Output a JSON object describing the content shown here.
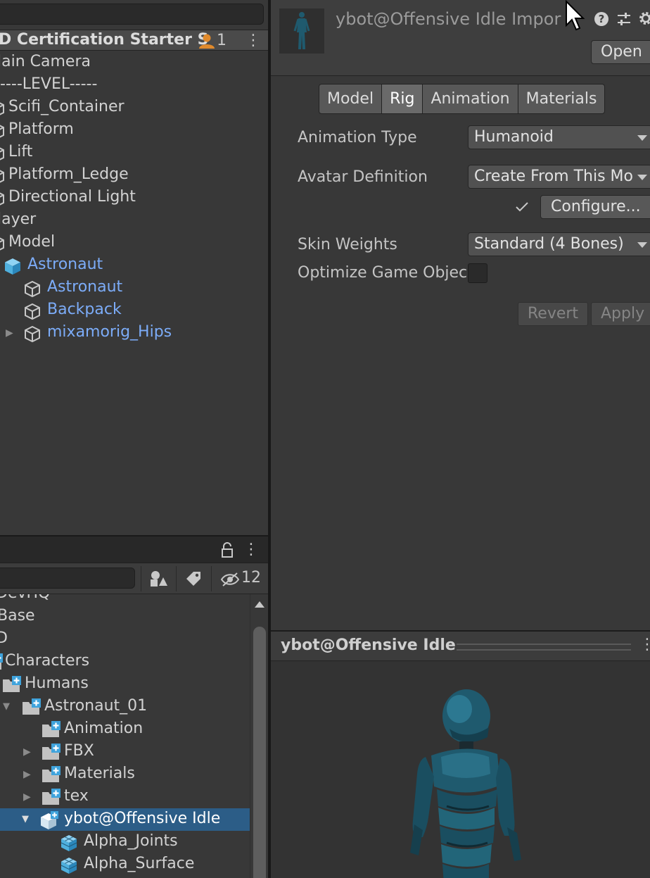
{
  "hierarchy": {
    "scene_name": "D Certification Starter S",
    "user_count": "1",
    "items": [
      {
        "label": "lain Camera"
      },
      {
        "label": "----LEVEL-----"
      },
      {
        "label": "Scifi_Container"
      },
      {
        "label": "Platform"
      },
      {
        "label": "Lift"
      },
      {
        "label": "Platform_Ledge"
      },
      {
        "label": "Directional Light"
      },
      {
        "label": "layer"
      },
      {
        "label": "Model"
      },
      {
        "label": "Astronaut"
      },
      {
        "label": "Astronaut"
      },
      {
        "label": "Backpack"
      },
      {
        "label": "mixamorig_Hips"
      }
    ]
  },
  "project": {
    "hidden_count": "12",
    "items": [
      {
        "label": "DevHQ"
      },
      {
        "label": "Base"
      },
      {
        "label": "D"
      },
      {
        "label": "Characters"
      },
      {
        "label": "Humans"
      },
      {
        "label": "Astronaut_01"
      },
      {
        "label": "Animation"
      },
      {
        "label": "FBX"
      },
      {
        "label": "Materials"
      },
      {
        "label": "tex"
      },
      {
        "label": "ybot@Offensive Idle"
      },
      {
        "label": "Alpha_Joints"
      },
      {
        "label": "Alpha_Surface"
      }
    ]
  },
  "inspector": {
    "title": "ybot@Offensive Idle Impor",
    "open_label": "Open",
    "tabs": [
      {
        "label": "Model"
      },
      {
        "label": "Rig",
        "active": true
      },
      {
        "label": "Animation"
      },
      {
        "label": "Materials"
      }
    ],
    "fields": {
      "animation_type": {
        "label": "Animation Type",
        "value": "Humanoid"
      },
      "avatar_definition": {
        "label": "Avatar Definition",
        "value": "Create From This Model"
      },
      "configure_label": "Configure...",
      "skin_weights": {
        "label": "Skin Weights",
        "value": "Standard (4 Bones)"
      },
      "optimize": {
        "label": "Optimize Game Objec",
        "checked": false
      }
    },
    "revert_label": "Revert",
    "apply_label": "Apply"
  },
  "preview": {
    "title": "ybot@Offensive Idle"
  },
  "colors": {
    "accent_blue_text": "#7cacf8",
    "selection": "#2c5d87",
    "panel_bg": "#383838",
    "user_icon": "#e08a2c",
    "model_teal": "#1f5a6e"
  }
}
